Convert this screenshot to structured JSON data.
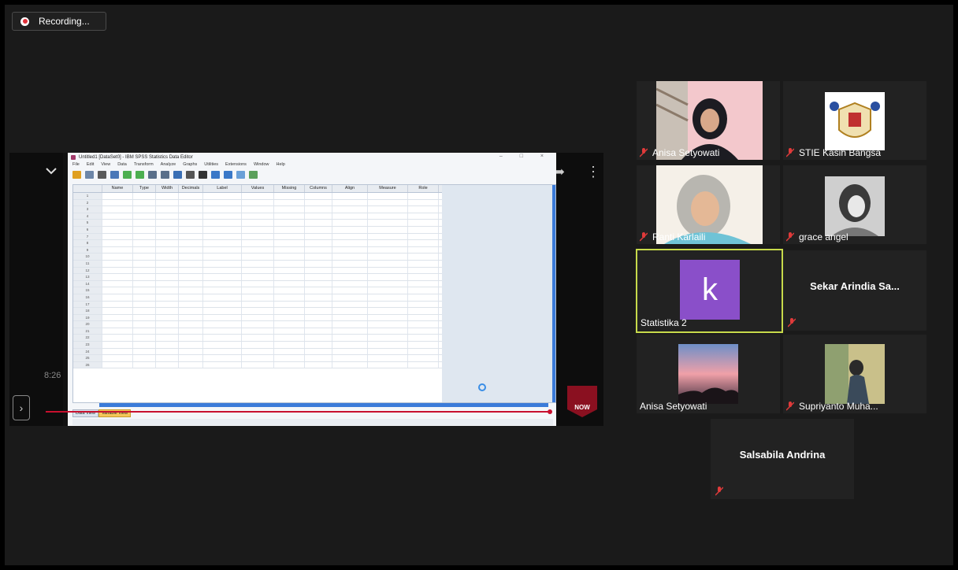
{
  "recording": {
    "label": "Recording..."
  },
  "shared": {
    "video_time": "8:26",
    "badge": "NOW",
    "spss": {
      "title": "Untitled1 [DataSet0] - IBM SPSS Statistics Data Editor",
      "window_controls": "– □ ×",
      "menu": [
        "File",
        "Edit",
        "View",
        "Data",
        "Transform",
        "Analyze",
        "Graphs",
        "Utilities",
        "Extensions",
        "Window",
        "Help"
      ],
      "columns": [
        "Name",
        "Type",
        "Width",
        "Decimals",
        "Label",
        "Values",
        "Missing",
        "Columns",
        "Align",
        "Measure",
        "Role"
      ],
      "rows": [
        "1",
        "2",
        "3",
        "4",
        "5",
        "6",
        "7",
        "8",
        "9",
        "10",
        "11",
        "12",
        "13",
        "14",
        "15",
        "16",
        "17",
        "18",
        "19",
        "20",
        "21",
        "22",
        "23",
        "24",
        "25",
        "26"
      ],
      "tabs": {
        "data_view": "Data View",
        "variable_view": "Variable View"
      }
    }
  },
  "participants": [
    {
      "name": "Anisa Setyowati",
      "muted": true
    },
    {
      "name": "STIE Kasih Bangsa",
      "muted": true
    },
    {
      "name": "Ranti Karlaili",
      "muted": true
    },
    {
      "name": "grace angel",
      "muted": true
    },
    {
      "name": "Statistika 2",
      "avatar_letter": "k",
      "active": true
    },
    {
      "name": "Sekar Arindia Sa...",
      "muted": true
    },
    {
      "name": "Anisa Setyowati",
      "muted": false
    },
    {
      "name": "Supriyanto Muha...",
      "muted": true
    },
    {
      "name": "Salsabila Andrina",
      "muted": true
    }
  ],
  "colors": {
    "active_border": "#c7da4b",
    "avatar_bg": "#8a4fc9",
    "mute_red": "#e03a3a"
  }
}
